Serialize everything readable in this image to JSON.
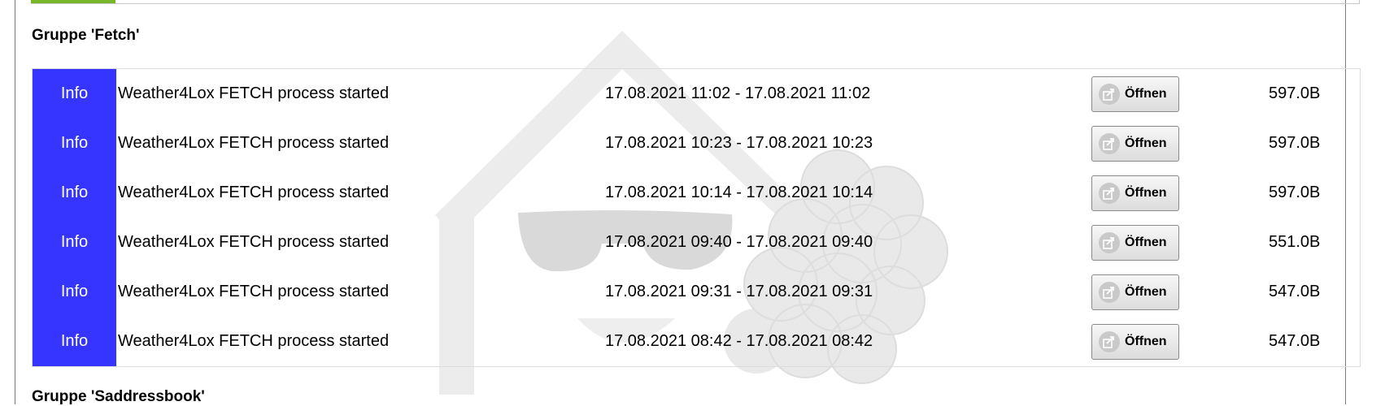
{
  "group": {
    "title": "Gruppe 'Fetch'",
    "next_title": "Gruppe 'Saddressbook'"
  },
  "colors": {
    "info_level": "#3535ff",
    "active_tab": "#78b72a"
  },
  "icons": {
    "open": "share-arrow-icon",
    "watermark": "loxberry-house-sunglasses-raspberry-logo"
  },
  "rows": [
    {
      "level": "Info",
      "message": "Weather4Lox FETCH process started",
      "time": "17.08.2021 11:02 - 17.08.2021 11:02",
      "button": "Öffnen",
      "size": "597.0B"
    },
    {
      "level": "Info",
      "message": "Weather4Lox FETCH process started",
      "time": "17.08.2021 10:23 - 17.08.2021 10:23",
      "button": "Öffnen",
      "size": "597.0B"
    },
    {
      "level": "Info",
      "message": "Weather4Lox FETCH process started",
      "time": "17.08.2021 10:14 - 17.08.2021 10:14",
      "button": "Öffnen",
      "size": "597.0B"
    },
    {
      "level": "Info",
      "message": "Weather4Lox FETCH process started",
      "time": "17.08.2021 09:40 - 17.08.2021 09:40",
      "button": "Öffnen",
      "size": "551.0B"
    },
    {
      "level": "Info",
      "message": "Weather4Lox FETCH process started",
      "time": "17.08.2021 09:31 - 17.08.2021 09:31",
      "button": "Öffnen",
      "size": "547.0B"
    },
    {
      "level": "Info",
      "message": "Weather4Lox FETCH process started",
      "time": "17.08.2021 08:42 - 17.08.2021 08:42",
      "button": "Öffnen",
      "size": "547.0B"
    }
  ]
}
